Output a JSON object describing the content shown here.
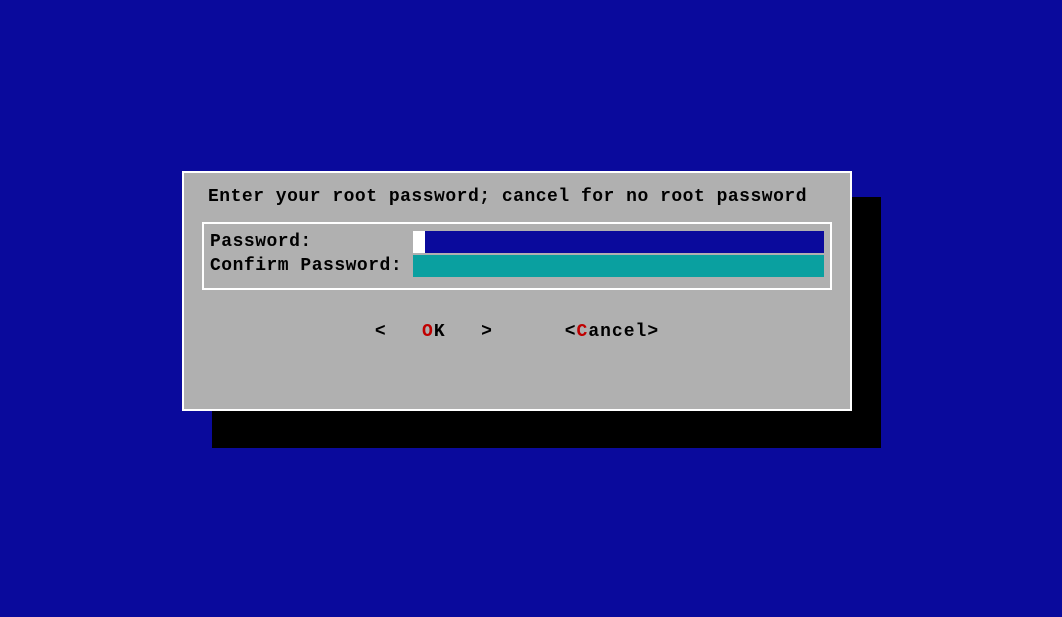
{
  "dialog": {
    "prompt": "Enter your root password; cancel for no root password",
    "fields": {
      "password_label": "Password:",
      "confirm_label": "Confirm Password:",
      "password_value": "",
      "confirm_value": ""
    },
    "buttons": {
      "ok": {
        "left_bracket": "<",
        "hotkey": "O",
        "rest": "K",
        "right_bracket": ">"
      },
      "cancel": {
        "left_bracket": "<",
        "hotkey": "C",
        "rest": "ancel",
        "right_bracket": ">"
      }
    }
  },
  "colors": {
    "background": "#0a0a9c",
    "dialog_bg": "#b0b0b0",
    "shadow": "#000000",
    "border": "#ffffff",
    "text": "#000000",
    "hotkey": "#c00000",
    "input_active": "#0a0a9c",
    "input_confirm": "#0aa0a0",
    "cursor": "#ffffff"
  }
}
